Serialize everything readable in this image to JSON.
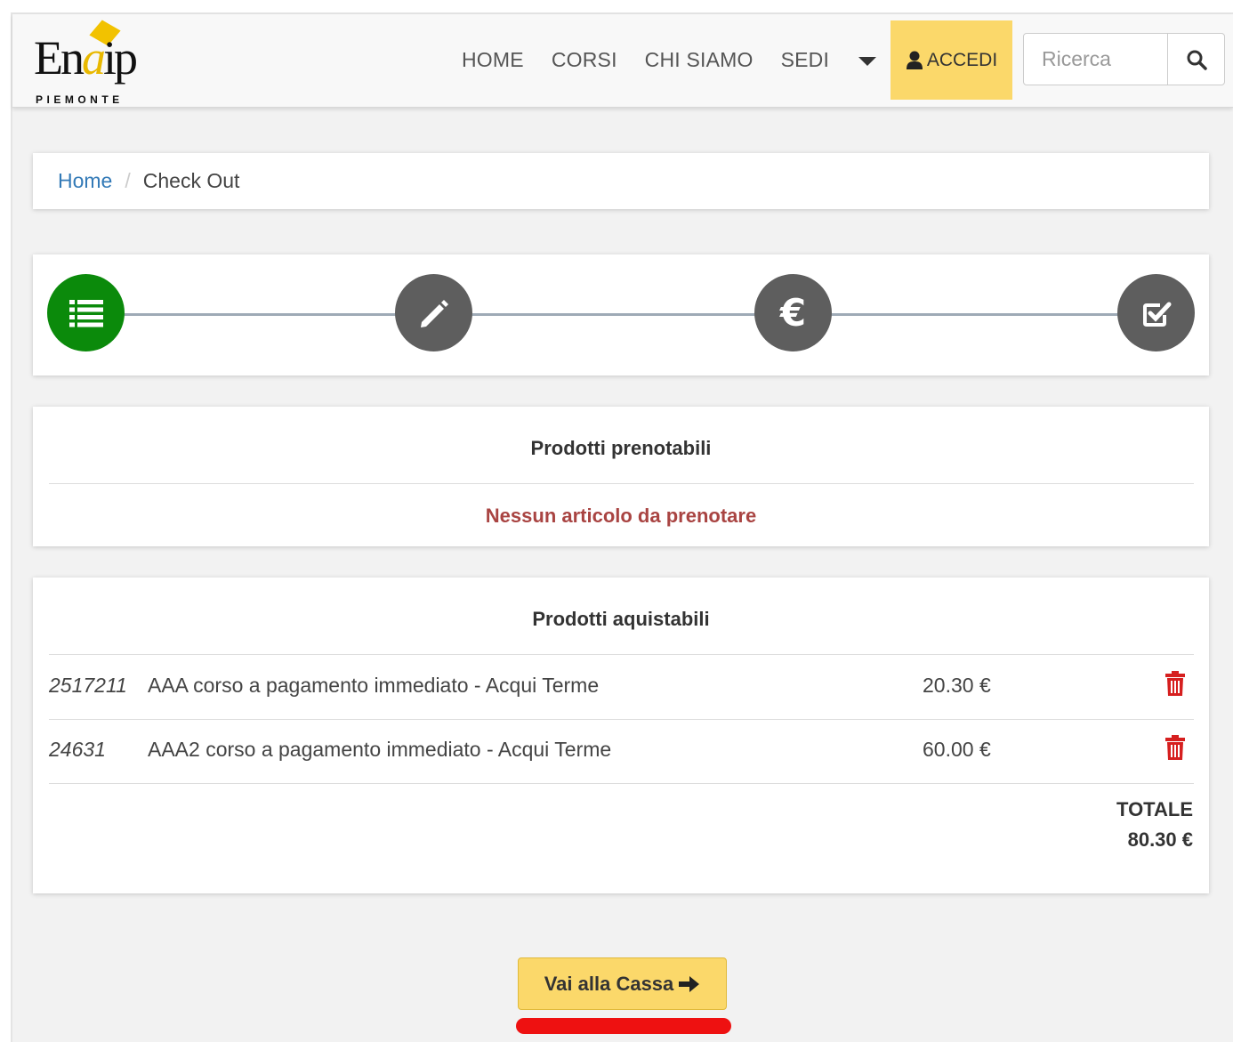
{
  "brand": {
    "logo_main": "Enaip",
    "logo_sub": "PIEMONTE"
  },
  "nav": {
    "items": [
      {
        "label": "HOME"
      },
      {
        "label": "CORSI"
      },
      {
        "label": "CHI SIAMO"
      },
      {
        "label": "SEDI"
      }
    ],
    "sedi_dropdown_icon": "caret-down-icon",
    "login_label": "ACCEDI",
    "login_icon": "user-icon",
    "search_placeholder": "Ricerca",
    "search_icon": "search-icon",
    "login_color": "#fbd86a"
  },
  "breadcrumb": {
    "home": "Home",
    "separator": "/",
    "current": "Check Out"
  },
  "checkout_steps": {
    "icons": [
      "list-icon",
      "pencil-icon",
      "euro-icon",
      "check-square-icon"
    ],
    "euro_symbol": "€",
    "active_step": 1,
    "active_color": "#0b8a0b",
    "inactive_color": "#5e5e5e"
  },
  "bookable": {
    "title": "Prodotti prenotabili",
    "empty_message": "Nessun articolo da prenotare"
  },
  "purchasable": {
    "title": "Prodotti aquistabili",
    "items": [
      {
        "code": "2517211",
        "name": "AAA corso a pagamento immediato - Acqui Terme",
        "price": "20.30 €"
      },
      {
        "code": "24631",
        "name": "AAA2 corso a pagamento immediato - Acqui Terme",
        "price": "60.00 €"
      }
    ],
    "delete_icon": "trash-icon",
    "total_label": "TOTALE",
    "total_value": "80.30 €"
  },
  "checkout_button": {
    "label": "Vai alla Cassa",
    "icon": "arrow-right-icon"
  }
}
